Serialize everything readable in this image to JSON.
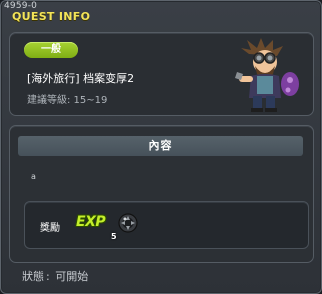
{
  "window": {
    "quest_id": "4959-0",
    "title": "QUEST INFO"
  },
  "quest": {
    "category_badge": "一般",
    "name": "[海外旅行] 档案变厚2",
    "recommended_level": "建議等級: 15~19",
    "npc_icon": "npc-character-portrait"
  },
  "content": {
    "header": "內容",
    "text": "a"
  },
  "reward": {
    "label": "獎勵",
    "exp_label": "EXP",
    "item_icon": "dark-orb-item",
    "item_count": "5"
  },
  "status": {
    "label": "狀態",
    "value": "可開始"
  },
  "colors": {
    "title_yellow": "#f3e45a",
    "badge_green": "#8fbd1d",
    "exp_green": "#c4ef2a",
    "panel_bg": "#2a2e33",
    "header_bg": "#4d5860"
  }
}
